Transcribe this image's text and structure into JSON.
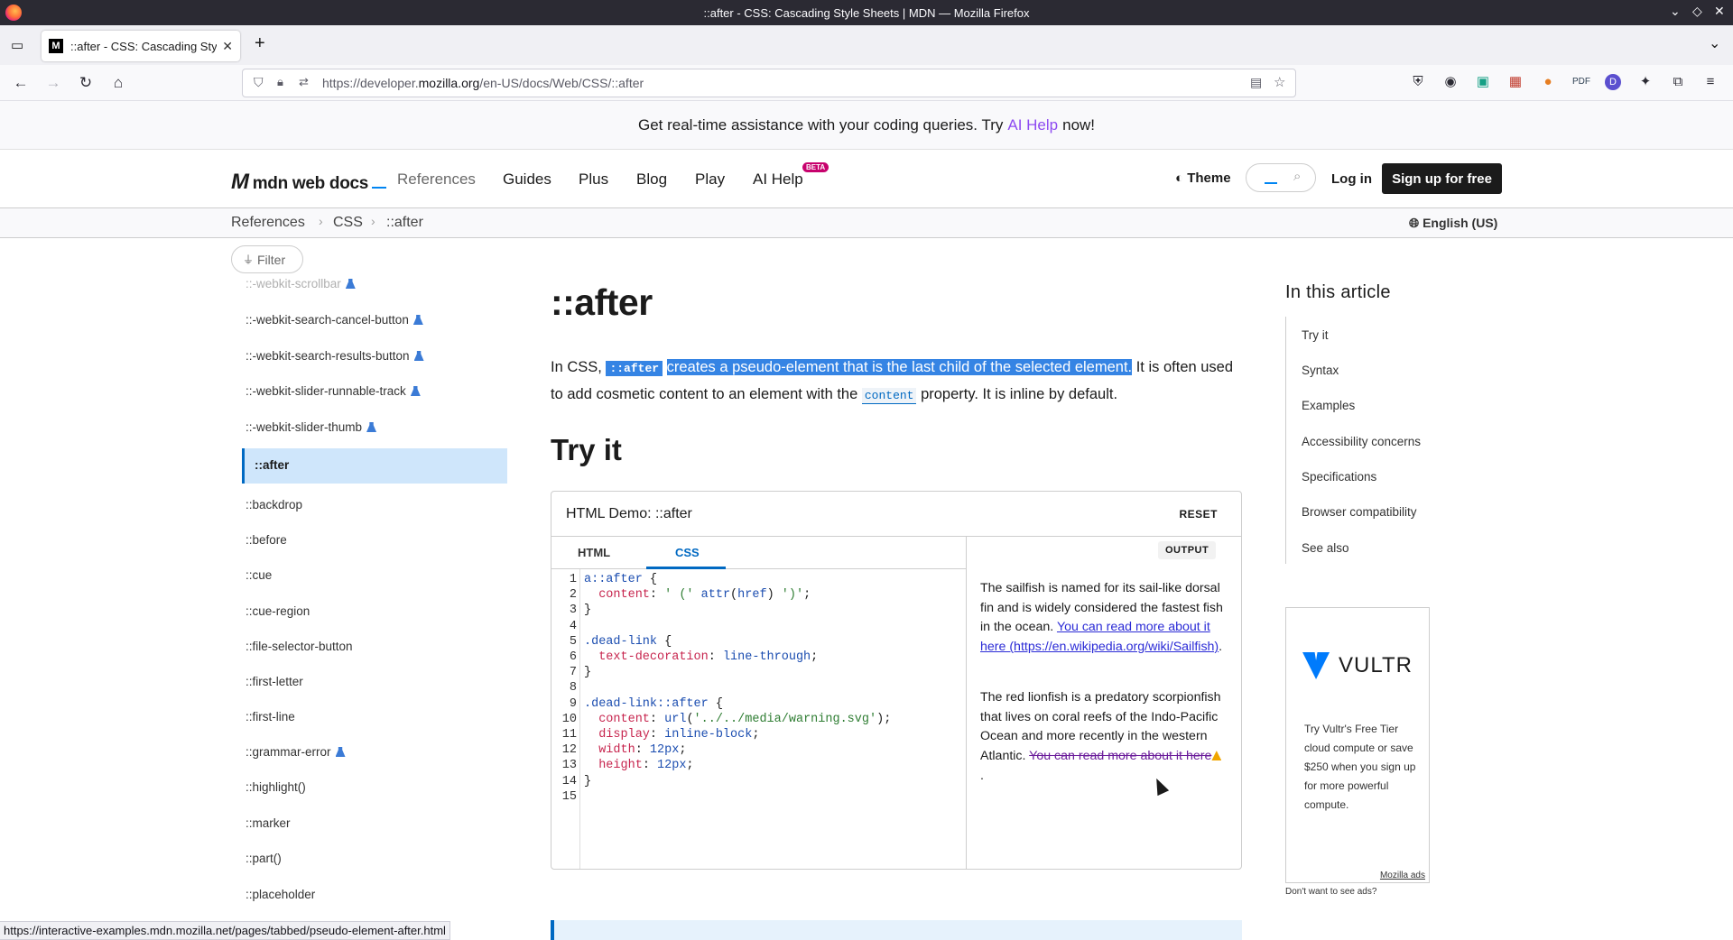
{
  "window": {
    "title": "::after - CSS: Cascading Style Sheets | MDN — Mozilla Firefox"
  },
  "tabs": [
    {
      "title": "::after - CSS: Cascading Sty",
      "favicon": "M"
    }
  ],
  "urlbar": {
    "prefix": "https://developer.",
    "domain": "mozilla.org",
    "path": "/en-US/docs/Web/CSS/::after"
  },
  "banner": {
    "text_before": "Get real-time assistance with your coding queries. Try",
    "link": "AI Help",
    "text_after": "now!"
  },
  "header": {
    "logo": "mdn web docs",
    "nav": [
      "References",
      "Guides",
      "Plus",
      "Blog",
      "Play",
      "AI Help"
    ],
    "beta": "BETA",
    "theme": "Theme",
    "login": "Log in",
    "signup": "Sign up for free"
  },
  "breadcrumbs": [
    "References",
    "CSS",
    "::after"
  ],
  "language": "English (US)",
  "sidebar": {
    "filter_placeholder": "Filter",
    "items": [
      {
        "label": "::-webkit-scrollbar",
        "experimental": true
      },
      {
        "label": "::-webkit-search-cancel-button",
        "experimental": true
      },
      {
        "label": "::-webkit-search-results-button",
        "experimental": true
      },
      {
        "label": "::-webkit-slider-runnable-track",
        "experimental": true
      },
      {
        "label": "::-webkit-slider-thumb",
        "experimental": true
      },
      {
        "label": "::after",
        "experimental": false
      },
      {
        "label": "::backdrop",
        "experimental": false
      },
      {
        "label": "::before",
        "experimental": false
      },
      {
        "label": "::cue",
        "experimental": false
      },
      {
        "label": "::cue-region",
        "experimental": false
      },
      {
        "label": "::file-selector-button",
        "experimental": false
      },
      {
        "label": "::first-letter",
        "experimental": false
      },
      {
        "label": "::first-line",
        "experimental": false
      },
      {
        "label": "::grammar-error",
        "experimental": true
      },
      {
        "label": "::highlight()",
        "experimental": false
      },
      {
        "label": "::marker",
        "experimental": false
      },
      {
        "label": "::part()",
        "experimental": false
      },
      {
        "label": "::placeholder",
        "experimental": false
      }
    ]
  },
  "article": {
    "title": "::after",
    "intro_1": "In CSS,",
    "intro_code": "::after",
    "intro_hl": "creates a pseudo-element that is the last child of the selected element.",
    "intro_2": "It is often used to add cosmetic content to an element with the",
    "intro_code2": "content",
    "intro_3": "property. It is inline by default.",
    "tryit": "Try it"
  },
  "demo": {
    "title": "HTML Demo: ::after",
    "reset": "RESET",
    "tabs": [
      "HTML",
      "CSS"
    ],
    "output_label": "OUTPUT",
    "output_p1": "The sailfish is named for its sail-like dorsal fin and is widely considered the fastest fish in the ocean.",
    "output_p1_link": "You can read more about it here (https://en.wikipedia.org/wiki/Sailfish)",
    "output_p2": "The red lionfish is a predatory scorpionfish that lives on coral reefs of the Indo-Pacific Ocean and more recently in the western Atlantic.",
    "output_p2_link": "You can read more about it here"
  },
  "toc": {
    "title": "In this article",
    "items": [
      "Try it",
      "Syntax",
      "Examples",
      "Accessibility concerns",
      "Specifications",
      "Browser compatibility",
      "See also"
    ]
  },
  "ad": {
    "brand": "VULTR",
    "text": "Try Vultr's Free Tier cloud compute or save $250 when you sign up for more powerful compute.",
    "mozilla_ads": "Mozilla ads",
    "no_ads": "Don't want to see ads?"
  },
  "status": {
    "url": "https://interactive-examples.mdn.mozilla.net/pages/tabbed/pseudo-element-after.html"
  }
}
